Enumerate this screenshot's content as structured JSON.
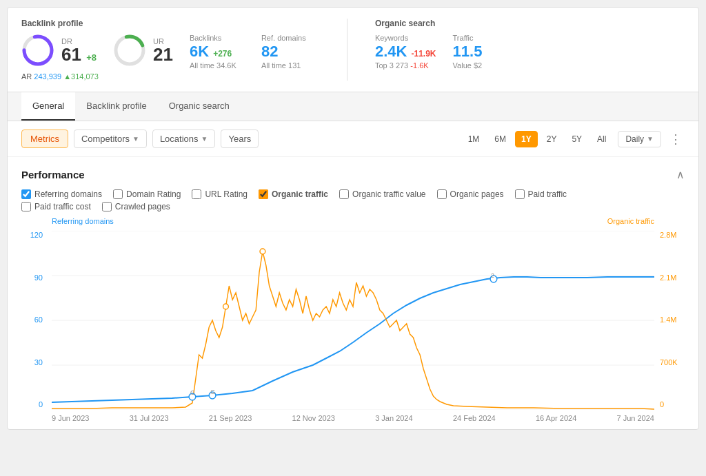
{
  "header": {
    "backlink_profile_title": "Backlink profile",
    "organic_search_title": "Organic search"
  },
  "stats": {
    "dr": {
      "label": "DR",
      "value": "61",
      "change": "+8"
    },
    "ur": {
      "label": "UR",
      "value": "21"
    },
    "ar": {
      "label": "AR",
      "value": "243,939",
      "change": "▲314,073"
    },
    "backlinks": {
      "label": "Backlinks",
      "value": "6K",
      "change": "+276",
      "sub": "All time 34.6K"
    },
    "ref_domains": {
      "label": "Ref. domains",
      "value": "82",
      "sub": "All time 131"
    },
    "keywords": {
      "label": "Keywords",
      "value": "2.4K",
      "change": "-11.9K",
      "top3": "273",
      "top3_change": "-1.6K"
    },
    "traffic": {
      "label": "Traffic",
      "value": "11.5",
      "value_sub": "Value $2"
    }
  },
  "tabs": [
    {
      "id": "general",
      "label": "General",
      "active": true
    },
    {
      "id": "backlink-profile",
      "label": "Backlink profile",
      "active": false
    },
    {
      "id": "organic-search",
      "label": "Organic search",
      "active": false
    }
  ],
  "toolbar": {
    "metrics_label": "Metrics",
    "competitors_label": "Competitors",
    "locations_label": "Locations",
    "years_label": "Years",
    "time_buttons": [
      "1M",
      "6M",
      "1Y",
      "2Y",
      "5Y",
      "All"
    ],
    "active_time": "1Y",
    "daily_label": "Daily",
    "more_icon": "⋮"
  },
  "performance": {
    "title": "Performance",
    "checkboxes": [
      {
        "id": "ref-domains",
        "label": "Referring domains",
        "checked": true,
        "color": "blue"
      },
      {
        "id": "domain-rating",
        "label": "Domain Rating",
        "checked": false,
        "color": "default"
      },
      {
        "id": "url-rating",
        "label": "URL Rating",
        "checked": false,
        "color": "default"
      },
      {
        "id": "organic-traffic",
        "label": "Organic traffic",
        "checked": true,
        "color": "orange"
      },
      {
        "id": "organic-value",
        "label": "Organic traffic value",
        "checked": false,
        "color": "default"
      },
      {
        "id": "organic-pages",
        "label": "Organic pages",
        "checked": false,
        "color": "default"
      },
      {
        "id": "paid-traffic",
        "label": "Paid traffic",
        "checked": false,
        "color": "default"
      },
      {
        "id": "paid-traffic-cost",
        "label": "Paid traffic cost",
        "checked": false,
        "color": "default"
      },
      {
        "id": "crawled-pages",
        "label": "Crawled pages",
        "checked": false,
        "color": "default"
      }
    ]
  },
  "chart": {
    "y_left_labels": [
      "120",
      "90",
      "60",
      "30",
      "0"
    ],
    "y_right_labels": [
      "2.8M",
      "2.1M",
      "1.4M",
      "700K",
      "0"
    ],
    "left_axis_label": "Referring domains",
    "right_axis_label": "Organic traffic",
    "x_labels": [
      "9 Jun 2023",
      "31 Jul 2023",
      "21 Sep 2023",
      "12 Nov 2023",
      "3 Jan 2024",
      "24 Feb 2024",
      "16 Apr 2024",
      "7 Jun 2024"
    ]
  }
}
